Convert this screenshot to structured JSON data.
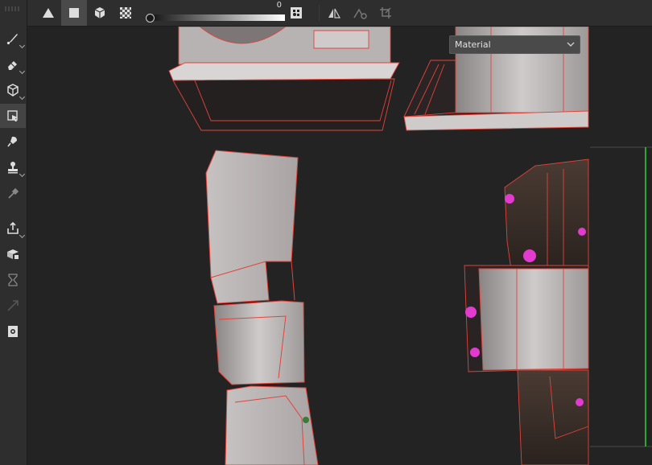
{
  "top_toolbar": {
    "opacity_value": "0",
    "tools": [
      {
        "name": "triangle-fill-icon"
      },
      {
        "name": "polygon-fill-icon"
      },
      {
        "name": "mesh-fill-icon"
      },
      {
        "name": "uv-fill-icon"
      },
      {
        "name": "wireframe-toggle-icon"
      },
      {
        "name": "mirror-icon"
      },
      {
        "name": "reset-icon"
      },
      {
        "name": "crop-icon"
      }
    ]
  },
  "left_toolbar": {
    "tools": [
      {
        "name": "paint-brush-icon"
      },
      {
        "name": "eraser-icon"
      },
      {
        "name": "projection-icon"
      },
      {
        "name": "polygon-fill-tool-icon",
        "active": true
      },
      {
        "name": "smudge-icon"
      },
      {
        "name": "clone-icon"
      },
      {
        "name": "color-picker-icon"
      },
      {
        "name": "export-icon"
      },
      {
        "name": "bake-icon"
      },
      {
        "name": "hourglass-icon"
      },
      {
        "name": "transform-icon"
      },
      {
        "name": "screenshot-icon"
      }
    ]
  },
  "viewport": {
    "material_select": "Material",
    "accent_wire": "#e2433a",
    "accent_magenta": "#e33bd0",
    "axis_green": "#2ed13a"
  }
}
